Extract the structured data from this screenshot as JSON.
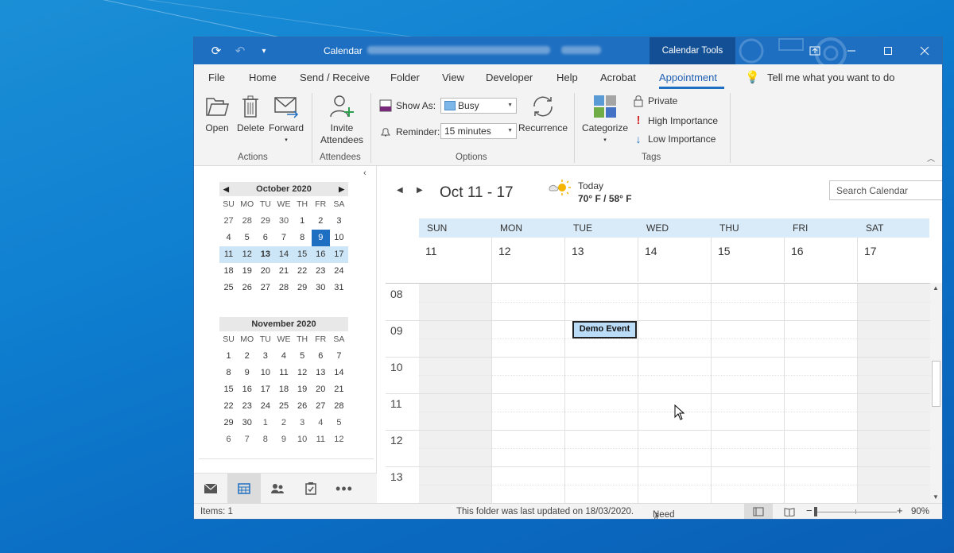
{
  "window": {
    "title": "Calendar",
    "contextual_tab_group": "Calendar Tools"
  },
  "menu": {
    "items": [
      "File",
      "Home",
      "Send / Receive",
      "Folder",
      "View",
      "Developer",
      "Help",
      "Acrobat",
      "Appointment"
    ],
    "active": "Appointment",
    "tell_me": "Tell me what you want to do"
  },
  "ribbon": {
    "actions": {
      "open": "Open",
      "delete": "Delete",
      "forward": "Forward",
      "group": "Actions"
    },
    "attendees": {
      "invite_line1": "Invite",
      "invite_line2": "Attendees",
      "group": "Attendees"
    },
    "options": {
      "show_as_label": "Show As:",
      "show_as_value": "Busy",
      "reminder_label": "Reminder:",
      "reminder_value": "15 minutes",
      "recurrence": "Recurrence",
      "group": "Options"
    },
    "tags": {
      "categorize": "Categorize",
      "private": "Private",
      "high": "High Importance",
      "low": "Low Importance",
      "group": "Tags"
    }
  },
  "mini_calendars": [
    {
      "title": "October 2020",
      "dow": [
        "SU",
        "MO",
        "TU",
        "WE",
        "TH",
        "FR",
        "SA"
      ],
      "weeks": [
        [
          "27",
          "28",
          "29",
          "30",
          "1",
          "2",
          "3"
        ],
        [
          "4",
          "5",
          "6",
          "7",
          "8",
          "9",
          "10"
        ],
        [
          "11",
          "12",
          "13",
          "14",
          "15",
          "16",
          "17"
        ],
        [
          "18",
          "19",
          "20",
          "21",
          "22",
          "23",
          "24"
        ],
        [
          "25",
          "26",
          "27",
          "28",
          "29",
          "30",
          "31"
        ]
      ]
    },
    {
      "title": "November 2020",
      "dow": [
        "SU",
        "MO",
        "TU",
        "WE",
        "TH",
        "FR",
        "SA"
      ],
      "weeks": [
        [
          "1",
          "2",
          "3",
          "4",
          "5",
          "6",
          "7"
        ],
        [
          "8",
          "9",
          "10",
          "11",
          "12",
          "13",
          "14"
        ],
        [
          "15",
          "16",
          "17",
          "18",
          "19",
          "20",
          "21"
        ],
        [
          "22",
          "23",
          "24",
          "25",
          "26",
          "27",
          "28"
        ],
        [
          "29",
          "30",
          "1",
          "2",
          "3",
          "4",
          "5"
        ],
        [
          "6",
          "7",
          "8",
          "9",
          "10",
          "11",
          "12"
        ]
      ]
    }
  ],
  "calendar": {
    "range": "Oct 11 - 17",
    "weather_today": "Today",
    "weather_temp": "70° F / 58° F",
    "search_placeholder": "Search Calendar",
    "day_names": [
      "SUN",
      "MON",
      "TUE",
      "WED",
      "THU",
      "FRI",
      "SAT"
    ],
    "day_numbers": [
      "11",
      "12",
      "13",
      "14",
      "15",
      "16",
      "17"
    ],
    "hours": [
      "08",
      "09",
      "10",
      "11",
      "12",
      "13"
    ],
    "event": {
      "title": "Demo Event",
      "day": "TUE",
      "start_hour": "09"
    }
  },
  "status": {
    "items": "Items: 1",
    "updated": "This folder was last updated on 18/03/2020.",
    "password": "Need Password",
    "zoom": "90%"
  },
  "colors": {
    "accent": "#1e6fc1",
    "titlebar": "#1e6fc1",
    "tools_tab": "#124f94",
    "event_fill": "#bbdcf7",
    "week_highlight": "#cde6f7"
  }
}
